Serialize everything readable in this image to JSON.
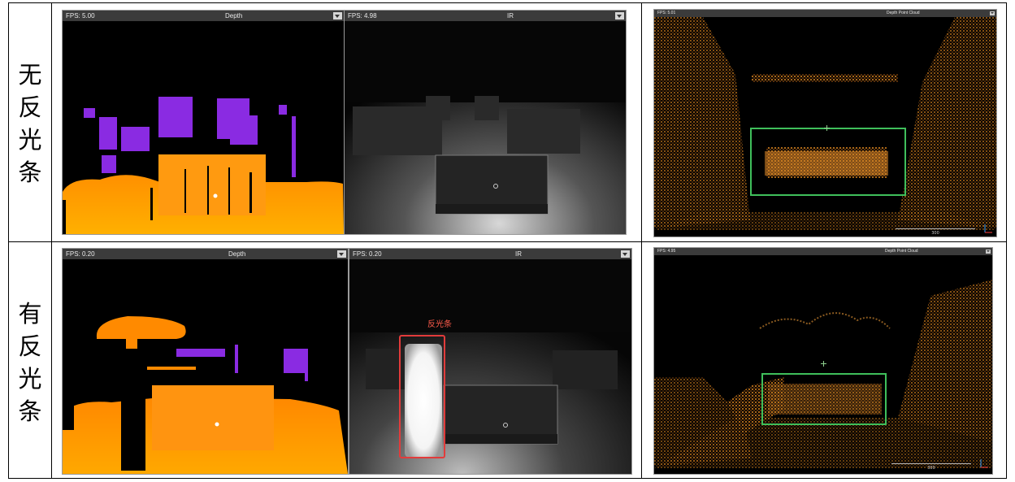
{
  "rows": [
    {
      "label_chars": [
        "无",
        "反",
        "光",
        "条"
      ],
      "depth_view": {
        "fps": "FPS: 5.00",
        "mode": "Depth"
      },
      "ir_view": {
        "fps": "FPS: 4.98",
        "mode": "IR"
      },
      "cloud_view": {
        "fps": "FPS: 5.01",
        "mode": "Depth Point Cloud",
        "scale": "300"
      }
    },
    {
      "label_chars": [
        "有",
        "反",
        "光",
        "条"
      ],
      "depth_view": {
        "fps": "FPS: 0.20",
        "mode": "Depth"
      },
      "ir_view": {
        "fps": "FPS: 0.20",
        "mode": "IR"
      },
      "cloud_view": {
        "fps": "FPS: 4.95",
        "mode": "Depth Point Cloud",
        "scale": "300"
      },
      "annotation": "反光条"
    }
  ],
  "colors": {
    "green_box": "#3fbf5b",
    "red_box": "#e23b3b",
    "depth_orange": "#ff9a00",
    "depth_purple": "#8a2be2"
  },
  "icons": {
    "dropdown": "chevron-down-icon",
    "axis": "axis-gizmo-icon"
  }
}
